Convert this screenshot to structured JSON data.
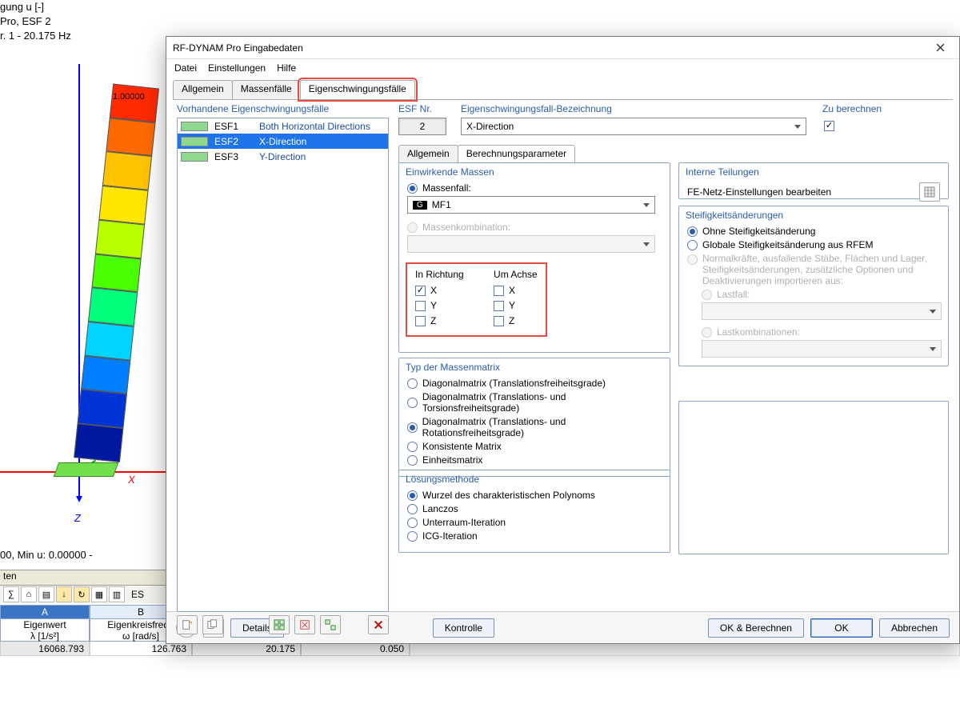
{
  "bg": {
    "top_lines": [
      "gung u [-]",
      "Pro, ESF 2",
      "r. 1 - 20.175 Hz"
    ],
    "legend_top": "1.00000",
    "axis_x": "X",
    "axis_z": "Z",
    "status": "00, Min u: 0.00000 -",
    "table_title": "ten",
    "esf_label": "ES",
    "column_segments": [
      "#ff2a00",
      "#ff6a00",
      "#ffc400",
      "#ffe600",
      "#b8ff00",
      "#4aff00",
      "#00ff7a",
      "#00d4ff",
      "#0080ff",
      "#0033d5",
      "#0018a0"
    ],
    "cols": {
      "A": {
        "hdr": "A",
        "t1": "Eigenwert",
        "t2": "λ [1/s²]",
        "v": "16068.793"
      },
      "B": {
        "hdr": "B",
        "t1": "Eigenkreisfrequ",
        "t2": "ω [rad/s]",
        "v": "126.763"
      },
      "C": {
        "v": "20.175"
      },
      "D": {
        "v": "0.050"
      }
    }
  },
  "dlg": {
    "title": "RF-DYNAM Pro Eingabedaten",
    "menu": {
      "datei": "Datei",
      "einstellungen": "Einstellungen",
      "hilfe": "Hilfe"
    },
    "tabs": {
      "allgemein": "Allgemein",
      "massen": "Massenfälle",
      "eigen": "Eigenschwingungsfälle"
    },
    "list": {
      "title": "Vorhandene Eigenschwingungsfälle",
      "items": [
        {
          "swatch": "#8fd98f",
          "code": "ESF1",
          "name": "Both Horizontal Directions",
          "sel": false
        },
        {
          "swatch": "#8fd98f",
          "code": "ESF2",
          "name": "X-Direction",
          "sel": true
        },
        {
          "swatch": "#8fd98f",
          "code": "ESF3",
          "name": "Y-Direction",
          "sel": false
        }
      ]
    },
    "hdr": {
      "esfnr_label": "ESF Nr.",
      "esfnr_value": "2",
      "bez_label": "Eigenschwingungsfall-Bezeichnung",
      "bez_value": "X-Direction",
      "zu_label": "Zu berechnen"
    },
    "subtabs": {
      "allgemein": "Allgemein",
      "berech": "Berechnungsparameter"
    },
    "massen": {
      "title": "Einwirkende Massen",
      "opt_massenfall": "Massenfall:",
      "massenfall_value": "MF1",
      "massenfall_tag": "G",
      "opt_kombi": "Massenkombination:",
      "dir_title": "In Richtung",
      "axis_title": "Um Achse",
      "X": "X",
      "Y": "Y",
      "Z": "Z"
    },
    "matrix": {
      "title": "Typ der Massenmatrix",
      "o1": "Diagonalmatrix (Translationsfreiheitsgrade)",
      "o2": "Diagonalmatrix (Translations- und Torsionsfreiheitsgrade)",
      "o3": "Diagonalmatrix (Translations- und Rotationsfreiheitsgrade)",
      "o4": "Konsistente Matrix",
      "o5": "Einheitsmatrix"
    },
    "solver": {
      "title": "Lösungsmethode",
      "o1": "Wurzel des charakteristischen Polynoms",
      "o2": "Lanczos",
      "o3": "Unterraum-Iteration",
      "o4": "ICG-Iteration"
    },
    "intern": {
      "title": "Interne Teilungen",
      "btn": "FE-Netz-Einstellungen bearbeiten"
    },
    "stiff": {
      "title": "Steifigkeitsänderungen",
      "o1": "Ohne Steifigkeitsänderung",
      "o2": "Globale Steifigkeitsänderung aus RFEM",
      "o3": "Normalkräfte, ausfallende Stäbe, Flächen und Lager, Steifigkeitsänderungen, zusätzliche Optionen und Deaktivierungen importieren aus:",
      "sub1": "Lastfall:",
      "sub2": "Lastkombinationen:"
    },
    "bottom": {
      "details": "Details",
      "kontrolle": "Kontrolle",
      "okcalc": "OK & Berechnen",
      "ok": "OK",
      "abbrechen": "Abbrechen"
    }
  }
}
